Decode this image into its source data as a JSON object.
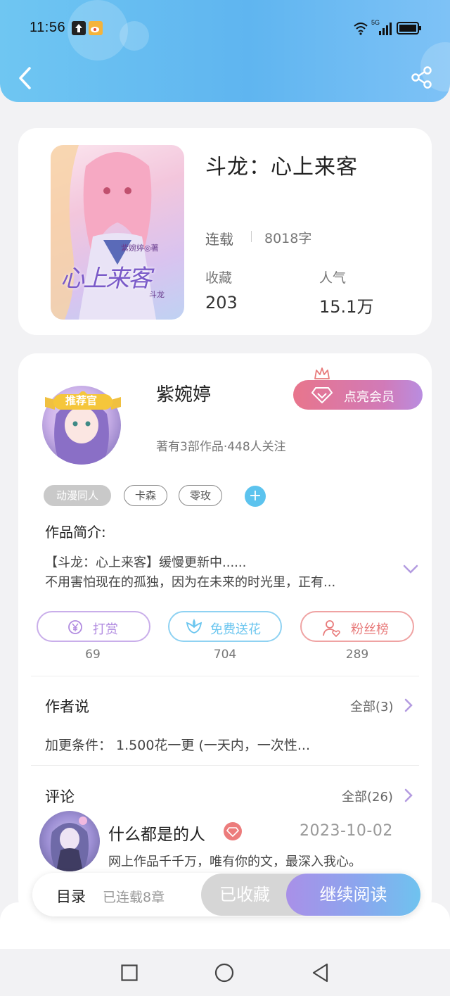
{
  "status_bar": {
    "time": "11:56",
    "network": "5G"
  },
  "header": {
    "back_icon": "chevron-left-icon",
    "share_icon": "share-icon",
    "color_start": "#6fc6f2",
    "color_end": "#7ec2f6"
  },
  "book": {
    "title": "斗龙：心上来客",
    "status": "连载",
    "word_count": "8018字",
    "favorites_label": "收藏",
    "favorites_value": "203",
    "popularity_label": "人气",
    "popularity_value": "15.1万",
    "cover_author_text": "紫婉婷◎著",
    "cover_title_art": "心上来客",
    "cover_series_text": "斗龙"
  },
  "author": {
    "badge": "推荐官",
    "name": "紫婉婷",
    "vip_button": "点亮会员",
    "info": "著有3部作品·448人关注",
    "tags": [
      "动漫同人",
      "卡森",
      "零玫"
    ],
    "add_tag_symbol": "+"
  },
  "intro": {
    "heading": "作品简介:",
    "line1": "【斗龙：心上来客】缓慢更新中......",
    "line2": "不用害怕现在的孤独，因为在未来的时光里，正有..."
  },
  "actions": [
    {
      "label": "打赏",
      "count": "69",
      "icon": "yuan-coin-icon",
      "color": "#b18be0"
    },
    {
      "label": "免费送花",
      "count": "704",
      "icon": "flower-icon",
      "color": "#6cc6ef"
    },
    {
      "label": "粉丝榜",
      "count": "289",
      "icon": "fan-user-icon",
      "color": "#e87b7b"
    }
  ],
  "author_says": {
    "title": "作者说",
    "all_label": "全部(3)",
    "text": "加更条件：  1.500花一更 (一天内，一次性..."
  },
  "comments": {
    "title": "评论",
    "all_label": "全部(26)",
    "items": [
      {
        "user": "什么都是的人",
        "date": "2023-10-02",
        "text": "网上作品千千万，唯有你的文，最深入我心。"
      }
    ]
  },
  "bottom_bar": {
    "toc_label": "目录",
    "toc_status": "已连载8章",
    "collected_label": "已收藏",
    "continue_label": "继续阅读"
  },
  "colors": {
    "accent_purple": "#b18be0",
    "accent_blue": "#6cc6ef",
    "accent_red": "#e87b7b"
  }
}
